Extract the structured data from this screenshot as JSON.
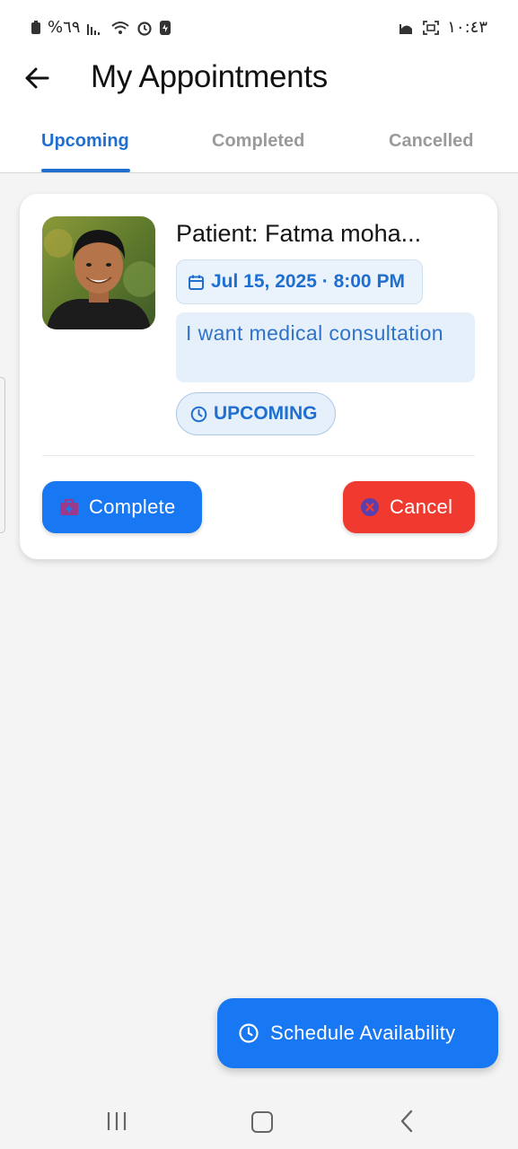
{
  "status_bar": {
    "battery_percent": "%٦٩",
    "time": "١٠:٤٣"
  },
  "header": {
    "title": "My Appointments"
  },
  "tabs": [
    {
      "label": "Upcoming",
      "active": true
    },
    {
      "label": "Completed",
      "active": false
    },
    {
      "label": "Cancelled",
      "active": false
    }
  ],
  "appointment": {
    "patient_name": "Patient: Fatma moha...",
    "datetime": "Jul 15, 2025 · 8:00 PM",
    "note": "I want medical consultation",
    "status": "UPCOMING",
    "actions": {
      "complete_label": "Complete",
      "cancel_label": "Cancel"
    }
  },
  "fab": {
    "label": "Schedule Availability"
  },
  "colors": {
    "primary": "#1877f2",
    "accent_text": "#1f6fd1",
    "danger": "#f03a2f",
    "chip_bg": "#e6f0fb"
  }
}
